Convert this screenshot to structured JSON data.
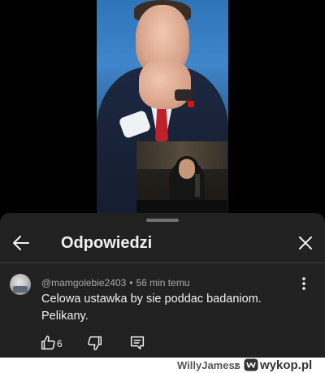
{
  "sheet": {
    "title": "Odpowiedzi",
    "back_icon": "arrow-left-icon",
    "close_icon": "close-icon"
  },
  "comment": {
    "author": "@mamgolebie2403",
    "separator": "•",
    "time": "56 min temu",
    "text": "Celowa ustawka by sie poddac badaniom. Pelikany.",
    "like_count": "6",
    "icons": [
      "thumb-up-icon",
      "thumb-down-icon",
      "reply-icon",
      "more-vert-icon"
    ]
  },
  "watermark": {
    "user": "WillyJamess",
    "separator": "z",
    "brand": "wykop.pl"
  },
  "colors": {
    "sheet_bg": "#212121",
    "text_primary": "#f1f1f1",
    "text_secondary": "#aaaaaa"
  }
}
